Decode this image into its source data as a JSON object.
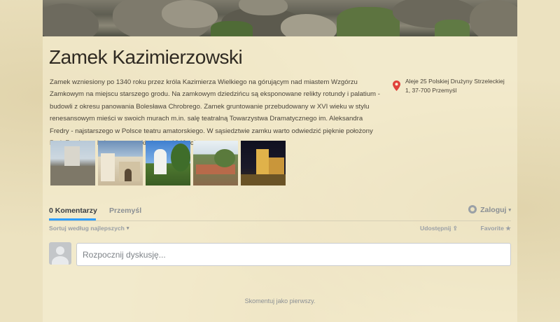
{
  "place": {
    "title": "Zamek Kazimierzowski",
    "description": "Zamek wzniesiony po 1340 roku przez króla Kazimierza Wielkiego na górującym nad miastem Wzgórzu Zamkowym na miejscu starszego grodu. Na zamkowym dziedzińcu są eksponowane relikty rotundy i palatium - budowli z okresu panowania Bolesława Chrobrego. Zamek gruntowanie przebudowany w XVI wieku w stylu renesansowym mieści w swoich murach m.in. salę teatralną Towarzystwa Dramatycznego im. Aleksandra Fredry - najstarszego w Polsce teatru amatorskiego. W sąsiedztwie zamku warto odwiedzić pięknie położony Park Zamkowy, którego początki sięgają 1842 roku.",
    "address": "Aleje 25 Polskiej Drużyny Strzeleckiej 1, 37-700 Przemyśl",
    "pin_icon": "map-pin-icon",
    "pin_color": "#e0413a"
  },
  "gallery": {
    "thumbnails": [
      "castle-photo-1",
      "castle-photo-2",
      "castle-photo-3",
      "castle-photo-4",
      "castle-photo-5"
    ]
  },
  "comments": {
    "tab_comments": "0 Komentarzy",
    "tab_user": "Przemyśl",
    "login_label": "Zaloguj",
    "login_caret": "▾",
    "sort_label": "Sortuj według najlepszych",
    "sort_caret": "▾",
    "share_label": "Udostępnij",
    "share_icon": "⇪",
    "favorite_label": "Favorite",
    "favorite_icon": "★",
    "input_placeholder": "Rozpocznij dyskusję...",
    "empty_message": "Skomentuj jako pierwszy.",
    "accent_color": "#2e9fff"
  }
}
